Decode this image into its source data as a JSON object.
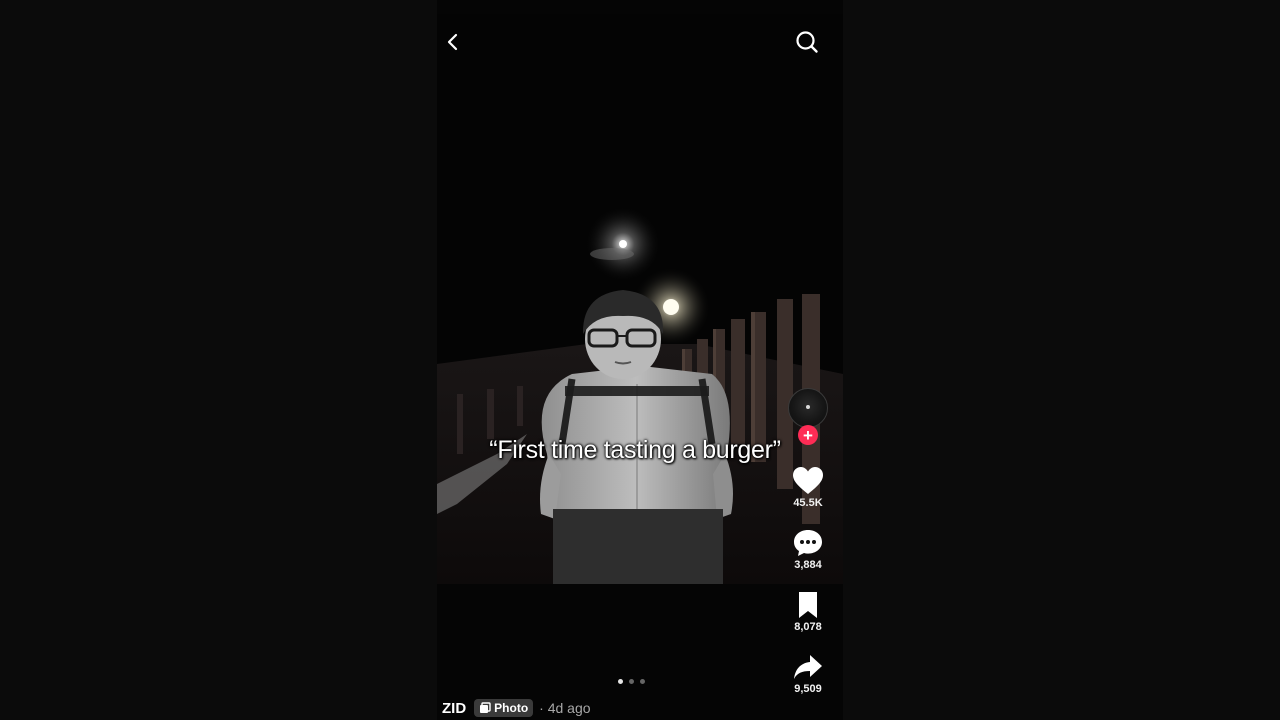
{
  "caption": "“First time tasting a burger”",
  "creator": {
    "username": "ZID",
    "post_type": "Photo",
    "posted": "· 4d ago"
  },
  "actions": {
    "likes": "45.5K",
    "comments": "3,884",
    "saves": "8,078",
    "shares": "9,509"
  },
  "carousel": {
    "total": 3,
    "current": 1
  },
  "icons": [
    "back-arrow-icon",
    "search-icon",
    "plus-icon",
    "heart-icon",
    "comment-icon",
    "bookmark-icon",
    "share-icon",
    "photo-icon"
  ],
  "colors": {
    "accent": "#fe2c55",
    "background": "#050505"
  }
}
